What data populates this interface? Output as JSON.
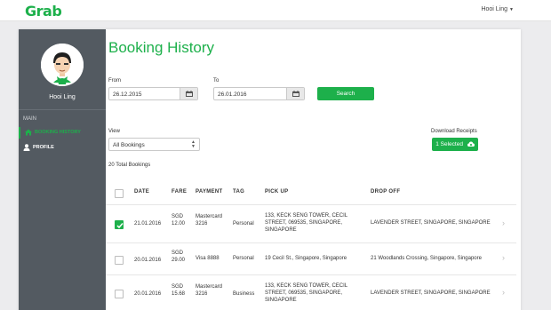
{
  "app": {
    "logo": "Grab"
  },
  "header": {
    "user_name": "Hooi Ling",
    "caret": "▼"
  },
  "sidebar": {
    "name": "Hooi Ling",
    "section": "MAIN",
    "items": [
      {
        "label": "BOOKING HISTORY",
        "icon": "home-icon",
        "active": true
      },
      {
        "label": "PROFILE",
        "icon": "user-icon",
        "active": false
      }
    ]
  },
  "page": {
    "title": "Booking History"
  },
  "filters": {
    "from_label": "From",
    "from_value": "26.12.2015",
    "to_label": "To",
    "to_value": "26.01.2016",
    "search_label": "Search",
    "view_label": "View",
    "view_value": "All Bookings",
    "download_label": "Download Receipts",
    "selected_label": "1 Selected"
  },
  "summary": {
    "total": "20 Total Bookings"
  },
  "table": {
    "headers": [
      "DATE",
      "FARE",
      "PAYMENT",
      "TAG",
      "PICK UP",
      "DROP OFF"
    ],
    "rows": [
      {
        "checked": true,
        "date": "21.01.2016",
        "fare_cur": "SGD",
        "fare_amt": "12.00",
        "pay_1": "Mastercard",
        "pay_2": "3216",
        "tag": "Personal",
        "pick_1": "133, KECK SENG TOWER, CECIL",
        "pick_2": "STREET, 069535, SINGAPORE,",
        "pick_3": "SINGAPORE",
        "drop": "LAVENDER STREET, SINGAPORE, SINGAPORE"
      },
      {
        "checked": false,
        "date": "20.01.2016",
        "fare_cur": "SGD",
        "fare_amt": "29.00",
        "pay_1": "Visa 8888",
        "pay_2": "",
        "tag": "Personal",
        "pick_1": "19 Cecil St., Singapore, Singapore",
        "pick_2": "",
        "pick_3": "",
        "drop": "21 Woodlands Crossing, Singapore, Singapore"
      },
      {
        "checked": false,
        "date": "20.01.2016",
        "fare_cur": "SGD",
        "fare_amt": "15.68",
        "pay_1": "Mastercard",
        "pay_2": "3216",
        "tag": "Business",
        "pick_1": "133, KECK SENG TOWER, CECIL",
        "pick_2": "STREET, 069535, SINGAPORE,",
        "pick_3": "SINGAPORE",
        "drop": "LAVENDER STREET, SINGAPORE, SINGAPORE"
      }
    ]
  },
  "colors": {
    "accent": "#1db04b",
    "sidebar": "#535a61",
    "background": "#ececee"
  }
}
